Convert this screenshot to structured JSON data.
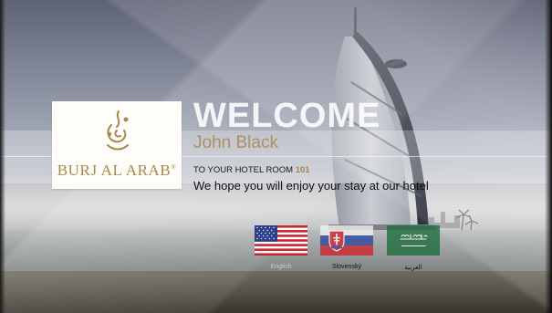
{
  "welcome": {
    "title": "WELCOME",
    "guest_name": "John Black",
    "room_prefix": "TO YOUR HOTEL ROOM",
    "room_number": "101",
    "message": "We hope you will enjoy your stay at our hotel"
  },
  "logo": {
    "text": "BURJ AL ARAB",
    "mark": "®",
    "color": "#a8884c"
  },
  "languages": [
    {
      "label": "English",
      "flag": "us-flag-icon",
      "selected": true
    },
    {
      "label": "Slovenský",
      "flag": "slovakia-flag-icon",
      "selected": false
    },
    {
      "label": "العربية",
      "flag": "saudi-flag-icon",
      "selected": false
    }
  ],
  "colors": {
    "accent_gold": "#a8884c",
    "name_gold": "#ad9060"
  }
}
